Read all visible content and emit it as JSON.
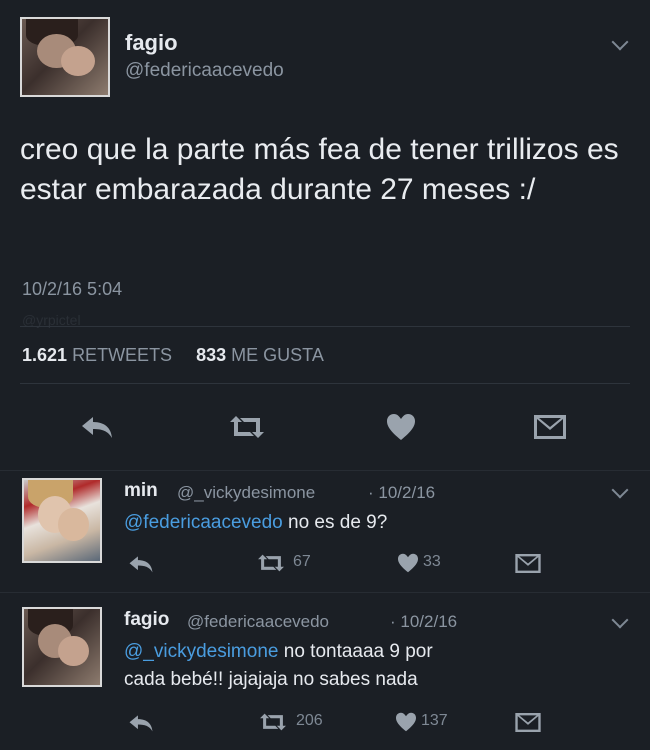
{
  "main_tweet": {
    "author_name": "fagio",
    "author_handle": "@federicaacevedo",
    "text": "creo que la parte más fea de tener trillizos es estar embarazada durante 27 meses :/",
    "timestamp": "10/2/16 5:04",
    "watermark": "@yrpictel",
    "retweets_count": "1.621",
    "retweets_label": "RETWEETS",
    "likes_count": "833",
    "likes_label": "ME GUSTA"
  },
  "replies": [
    {
      "author_name": "min",
      "author_handle": "@_vickydesimone",
      "date": "· 10/2/16",
      "mention": "@federicaacevedo",
      "text": " no es de 9?",
      "retweets": "67",
      "likes": "33"
    },
    {
      "author_name": "fagio",
      "author_handle": "@federicaacevedo",
      "date": "· 10/2/16",
      "mention": "@_vickydesimone",
      "text": " no tontaaaa 9 por",
      "text_line2": "cada bebé!! jajajaja no sabes nada",
      "retweets": "206",
      "likes": "137"
    }
  ],
  "icons": [
    "reply-icon",
    "retweet-icon",
    "heart-icon",
    "dm-icon",
    "chevron-down-icon"
  ],
  "colors": {
    "background": "#1b1f25",
    "mention": "#4a9de0",
    "muted": "#8b95a1"
  }
}
